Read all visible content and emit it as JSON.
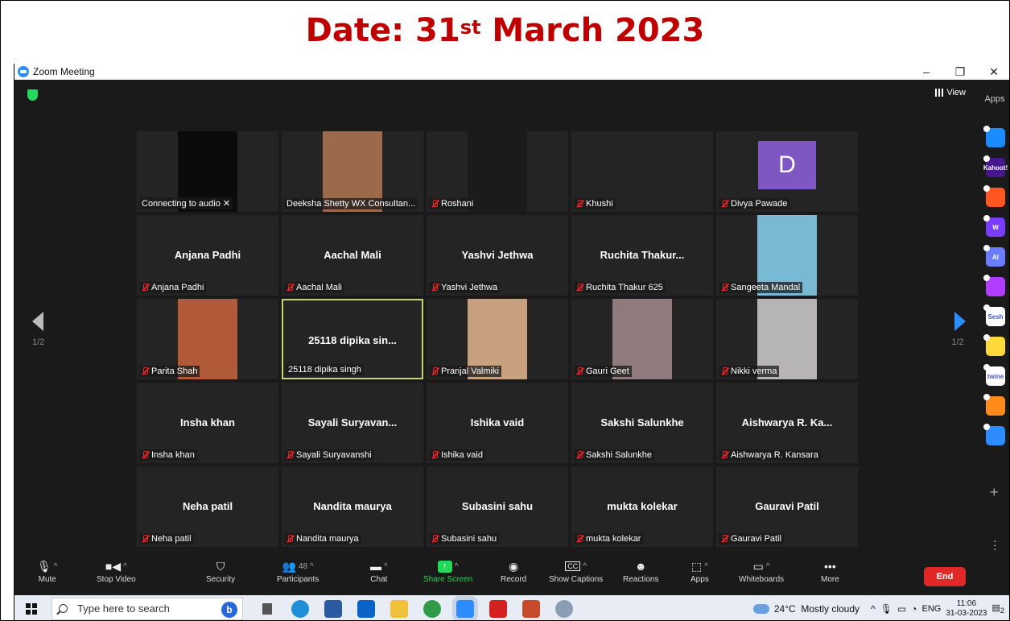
{
  "banner": {
    "prefix": "Date: 31",
    "sup": "st",
    "suffix": " March 2023"
  },
  "window": {
    "title": "Zoom Meeting",
    "minimize": "–",
    "restore": "❐",
    "close": "✕"
  },
  "meeting": {
    "view_label": "View",
    "page_indicator_left": "1/2",
    "page_indicator_right": "1/2"
  },
  "tiles": [
    {
      "label": "Connecting to audio ✕",
      "muted": false,
      "video": "#0b0b0b"
    },
    {
      "label": "Deeksha Shetty WX Consultan...",
      "muted": false,
      "video": "#9a6a4a"
    },
    {
      "label": "Roshani",
      "muted": true,
      "video": "#1b1b1b"
    },
    {
      "label": "Khushi",
      "muted": true
    },
    {
      "label": "Divya Pawade",
      "muted": true,
      "letter": "D"
    },
    {
      "label": "Anjana Padhi",
      "muted": true,
      "big": "Anjana Padhi"
    },
    {
      "label": "Aachal Mali",
      "muted": true,
      "big": "Aachal Mali"
    },
    {
      "label": "Yashvi Jethwa",
      "muted": true,
      "big": "Yashvi Jethwa"
    },
    {
      "label": "Ruchita Thakur 625",
      "muted": true,
      "big": "Ruchita Thakur..."
    },
    {
      "label": "Sangeeta Mandal",
      "muted": true,
      "video": "#7ab9d4"
    },
    {
      "label": "Parita Shah",
      "muted": true,
      "video": "#b05a3a"
    },
    {
      "label": "25118 dipika singh",
      "muted": false,
      "big": "25118 dipika sin...",
      "active": true
    },
    {
      "label": "Pranjal Valmiki",
      "muted": true,
      "video": "#c9a07e"
    },
    {
      "label": "Gauri Geet",
      "muted": true,
      "video": "#8f7a7e"
    },
    {
      "label": "Nikki verma",
      "muted": true,
      "video": "#b7b4b6"
    },
    {
      "label": "Insha khan",
      "muted": true,
      "big": "Insha khan"
    },
    {
      "label": "Sayali Suryavanshi",
      "muted": true,
      "big": "Sayali Suryavan..."
    },
    {
      "label": "Ishika vaid",
      "muted": true,
      "big": "Ishika vaid"
    },
    {
      "label": "Sakshi Salunkhe",
      "muted": true,
      "big": "Sakshi Salunkhe"
    },
    {
      "label": "Aishwarya R. Kansara",
      "muted": true,
      "big": "Aishwarya R. Ka..."
    },
    {
      "label": "Neha patil",
      "muted": true,
      "big": "Neha patil"
    },
    {
      "label": "Nandita maurya",
      "muted": true,
      "big": "Nandita maurya"
    },
    {
      "label": "Subasini sahu",
      "muted": true,
      "big": "Subasini sahu"
    },
    {
      "label": "mukta kolekar",
      "muted": true,
      "big": "mukta kolekar"
    },
    {
      "label": "Gauravi Patil",
      "muted": true,
      "big": "Gauravi Patil"
    }
  ],
  "toolbar": {
    "mute": "Mute",
    "stop_video": "Stop Video",
    "security": "Security",
    "participants": "Participants",
    "participant_count": "48",
    "chat": "Chat",
    "share_screen": "Share Screen",
    "record": "Record",
    "captions": "Show Captions",
    "reactions": "Reactions",
    "apps": "Apps",
    "whiteboards": "Whiteboards",
    "more": "More",
    "end": "End",
    "help": "?"
  },
  "apps_panel": {
    "header": "Apps",
    "items": [
      {
        "name": "arrow-app-icon",
        "color": "#1a8cff",
        "text": ""
      },
      {
        "name": "kahoot-app-icon",
        "color": "#46178f",
        "text": "Kahoot!"
      },
      {
        "name": "orange-app-icon",
        "color": "#ff5722",
        "text": ""
      },
      {
        "name": "w-app-icon",
        "color": "#7a3cff",
        "text": "W"
      },
      {
        "name": "ai-app-icon",
        "color": "#6b7cff",
        "text": "AI"
      },
      {
        "name": "wave-app-icon",
        "color": "#b23cff",
        "text": ""
      },
      {
        "name": "sesh-app-icon",
        "color": "#ffffff",
        "text": "Sesh"
      },
      {
        "name": "emoji-app-icon",
        "color": "#ffd93b",
        "text": ""
      },
      {
        "name": "twine-app-icon",
        "color": "#ffffff",
        "text": "twine"
      },
      {
        "name": "blocks-app-icon",
        "color": "#ff8c1a",
        "text": ""
      },
      {
        "name": "refresh-app-icon",
        "color": "#2d8cff",
        "text": ""
      }
    ]
  },
  "taskbar": {
    "search_placeholder": "Type here to search",
    "weather": "24°C  Mostly cloudy",
    "lang": "ENG",
    "time": "11:06",
    "date": "31-03-2023",
    "notifications": "2"
  }
}
